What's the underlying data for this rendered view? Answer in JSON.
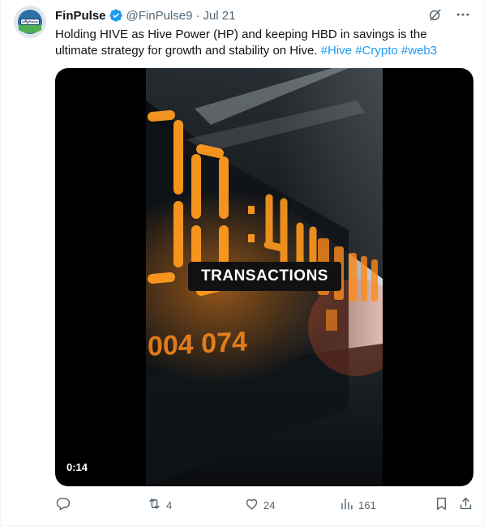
{
  "tweet": {
    "author_name": "FinPulse",
    "handle": "@FinPulse9",
    "separator": "·",
    "date": "Jul 21",
    "avatar_text": "FinPulse",
    "text": "Holding HIVE as Hive Power (HP) and keeping HBD in savings is the ultimate strategy for growth and stability on Hive.",
    "hashtags": [
      "#Hive",
      "#Crypto",
      "#web3"
    ]
  },
  "media": {
    "caption": "TRANSACTIONS",
    "duration": "0:14",
    "display_digits_large": "0:7:96:0",
    "display_digits_small": "004 074"
  },
  "actions": {
    "reply_count": "",
    "retweet_count": "4",
    "like_count": "24",
    "views_count": "161"
  },
  "colors": {
    "accent": "#1d9bf0",
    "verified": "#1d9bf0",
    "text_secondary": "#536471",
    "digit_orange": "#ff9a1f"
  }
}
